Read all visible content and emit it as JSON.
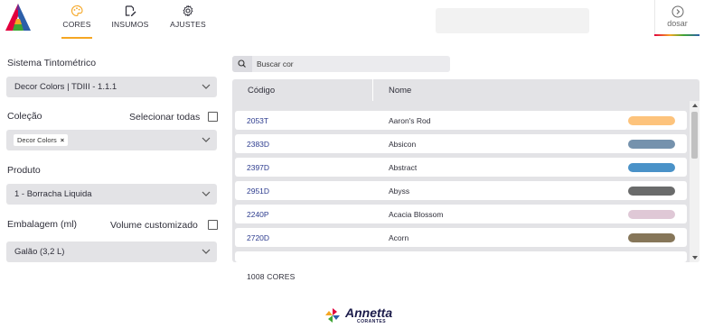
{
  "nav": {
    "tabs": [
      {
        "label": "CORES",
        "icon": "palette-icon",
        "active": true
      },
      {
        "label": "INSUMOS",
        "icon": "edit-note-icon",
        "active": false
      },
      {
        "label": "AJUSTES",
        "icon": "gear-icon",
        "active": false
      }
    ],
    "dosar_label": "dosar",
    "accent": "#f5a623"
  },
  "form": {
    "sistema": {
      "label": "Sistema Tintométrico",
      "value": "Decor Colors | TDIII - 1.1.1"
    },
    "colecao": {
      "label": "Coleção",
      "select_all_label": "Selecionar todas",
      "chip": "Decor Colors",
      "chip_remove": "×"
    },
    "produto": {
      "label": "Produto",
      "value": "1 - Borracha Liquida"
    },
    "embalagem": {
      "label": "Embalagem (ml)",
      "custom_label": "Volume customizado",
      "value": "Galão (3,2 L)"
    }
  },
  "search": {
    "placeholder": "Buscar cor",
    "icon": "search-icon"
  },
  "table": {
    "headers": {
      "code": "Código",
      "name": "Nome"
    },
    "rows": [
      {
        "code": "2053T",
        "name": "Aaron's Rod",
        "color": "#fdc37c"
      },
      {
        "code": "2383D",
        "name": "Absicon",
        "color": "#7592ad"
      },
      {
        "code": "2397D",
        "name": "Abstract",
        "color": "#4a92c8"
      },
      {
        "code": "2951D",
        "name": "Abyss",
        "color": "#6a6b6b"
      },
      {
        "code": "2240P",
        "name": "Acacia Blossom",
        "color": "#dfc8d6"
      },
      {
        "code": "2720D",
        "name": "Acorn",
        "color": "#867659"
      }
    ]
  },
  "count_label": "1008 CORES",
  "brand": {
    "name": "Annetta",
    "sub": "CORANTES"
  }
}
